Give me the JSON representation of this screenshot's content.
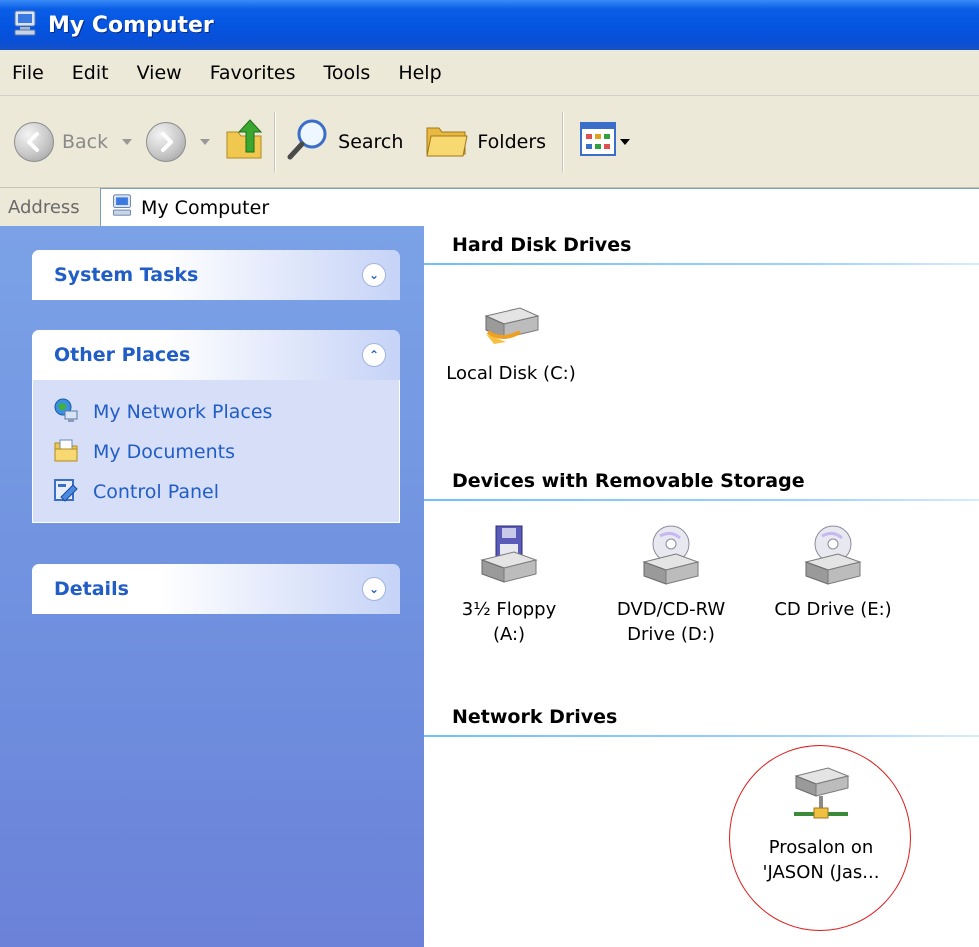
{
  "window": {
    "title": "My Computer"
  },
  "menu": [
    "File",
    "Edit",
    "View",
    "Favorites",
    "Tools",
    "Help"
  ],
  "toolbar": {
    "back": "Back",
    "search": "Search",
    "folders": "Folders"
  },
  "address": {
    "label": "Address",
    "value": "My Computer"
  },
  "taskpane": {
    "system_tasks": "System Tasks",
    "other_places": {
      "title": "Other Places",
      "items": [
        "My Network Places",
        "My Documents",
        "Control Panel"
      ]
    },
    "details": "Details"
  },
  "groups": {
    "hard_disk": "Hard Disk Drives",
    "removable": "Devices with Removable Storage",
    "network": "Network Drives"
  },
  "drives": {
    "local_c": "Local Disk (C:)",
    "floppy_l1": "3½ Floppy",
    "floppy_l2": "(A:)",
    "dvd_l1": "DVD/CD-RW",
    "dvd_l2": "Drive (D:)",
    "cd": "CD Drive (E:)",
    "net_l1": "Prosalon on",
    "net_l2": "'JASON (Jas..."
  },
  "colors": {
    "title_blue": "#0454e0",
    "link_blue": "#215dc6",
    "highlight_circle": "#e01a1a"
  }
}
